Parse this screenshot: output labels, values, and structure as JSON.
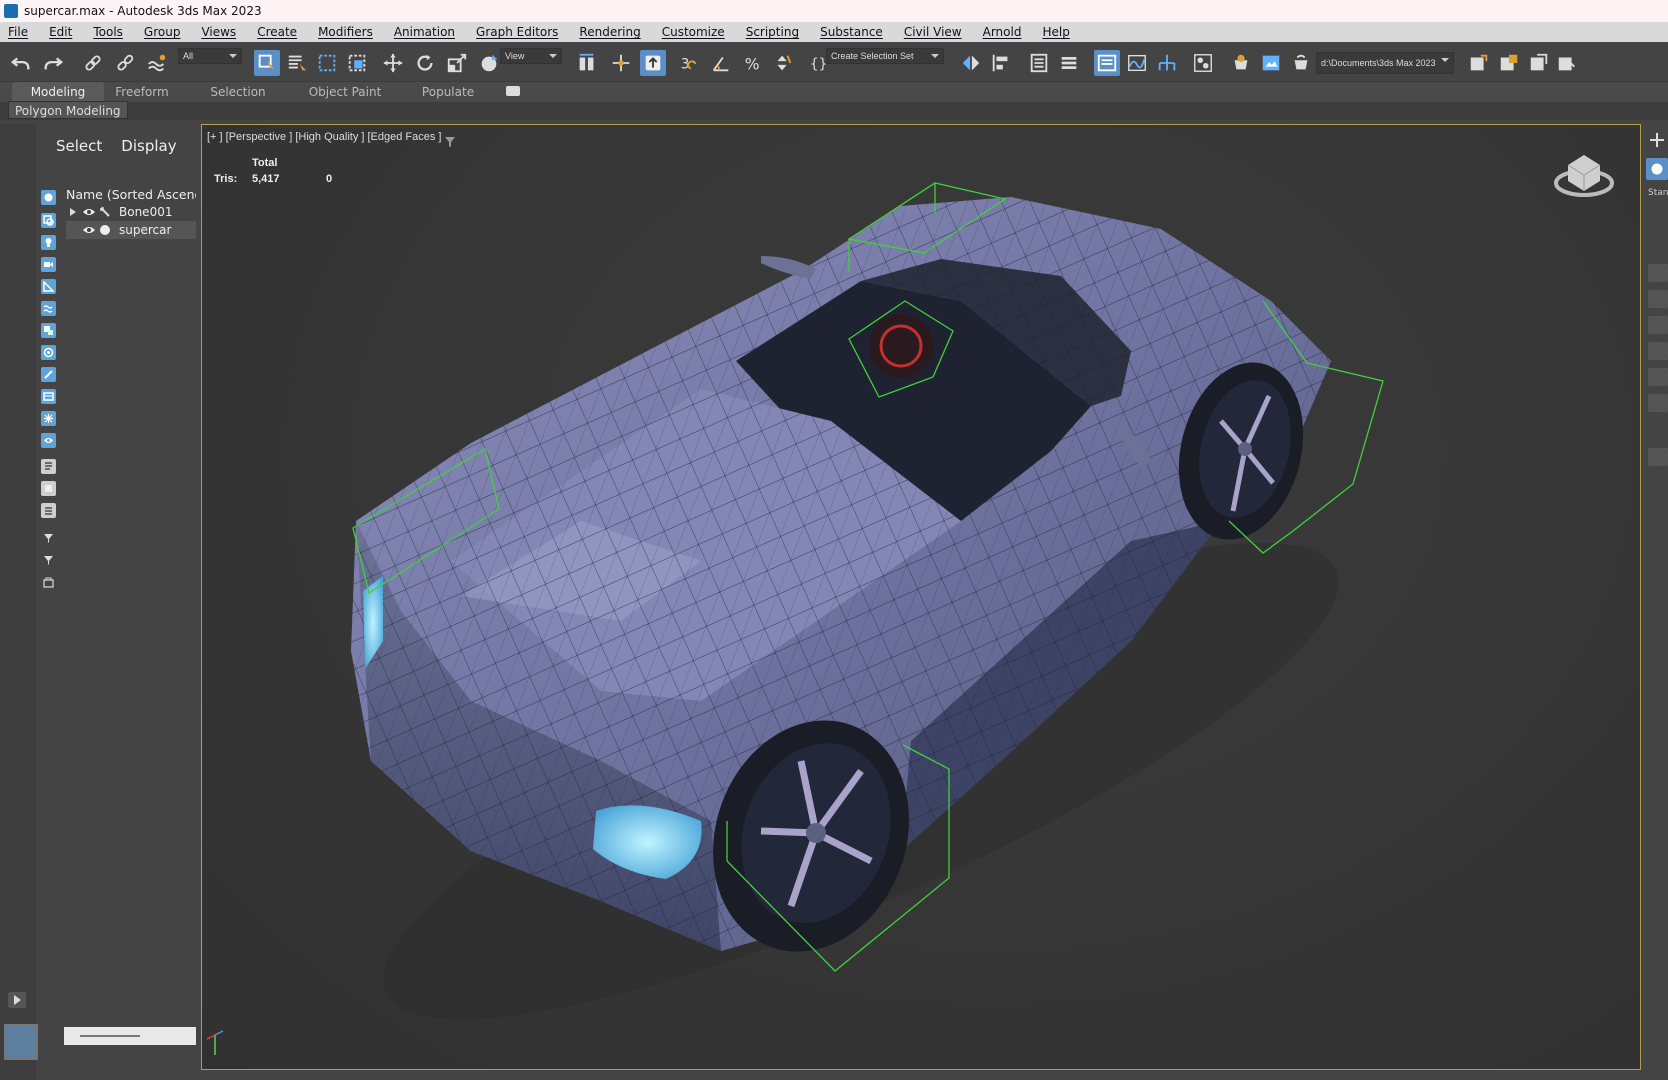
{
  "window": {
    "title": "supercar.max - Autodesk 3ds Max 2023"
  },
  "menu": [
    "File",
    "Edit",
    "Tools",
    "Group",
    "Views",
    "Create",
    "Modifiers",
    "Animation",
    "Graph Editors",
    "Rendering",
    "Customize",
    "Scripting",
    "Substance",
    "Civil View",
    "Arnold",
    "Help"
  ],
  "toolbar": {
    "selection_filter": "All",
    "coord_system": "View",
    "selection_set": "Create Selection Set",
    "project_path": "d:\\Documents\\3ds Max 2023"
  },
  "ribbon": {
    "tabs": [
      "Modeling",
      "Freeform",
      "Selection",
      "Object Paint",
      "Populate"
    ],
    "active_tab": "Modeling",
    "panel": "Polygon Modeling"
  },
  "explorer": {
    "tabs": [
      "Select",
      "Display"
    ],
    "column_header": "Name (Sorted Ascending)",
    "items": [
      {
        "name": "Bone001"
      },
      {
        "name": "supercar"
      }
    ]
  },
  "viewport": {
    "label": "[+ ] [Perspective ] [High Quality ] [Edged Faces ]",
    "stats_header": "Total",
    "stats_label": "Tris:",
    "stats_total": "5,417",
    "stats_selected": "0"
  },
  "right_panel": {
    "label": "Stand"
  },
  "colors": {
    "accent": "#5b8fc7",
    "viewport_border": "#b89a4c",
    "bbox": "#3fd13a",
    "car_body": "#7a7ea8"
  }
}
